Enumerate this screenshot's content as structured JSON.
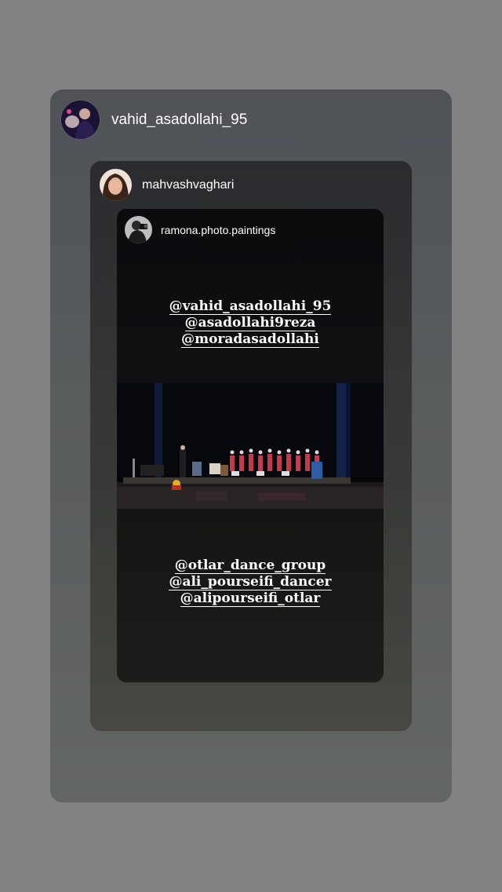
{
  "level1": {
    "username": "vahid_asadollahi_95",
    "avatar": "profile-photo"
  },
  "level2": {
    "username": "mahvashvaghari",
    "avatar": "profile-photo"
  },
  "level3": {
    "username": "ramona.photo.paintings",
    "avatar": "profile-photo",
    "mentions_top": [
      "@vahid_asadollahi_95",
      "@asadollahi9reza",
      "@moradasadollahi"
    ],
    "mentions_bottom": [
      "@otlar_dance_group",
      "@ali_pourseifi_dancer",
      "@alipourseifi_otlar"
    ]
  }
}
